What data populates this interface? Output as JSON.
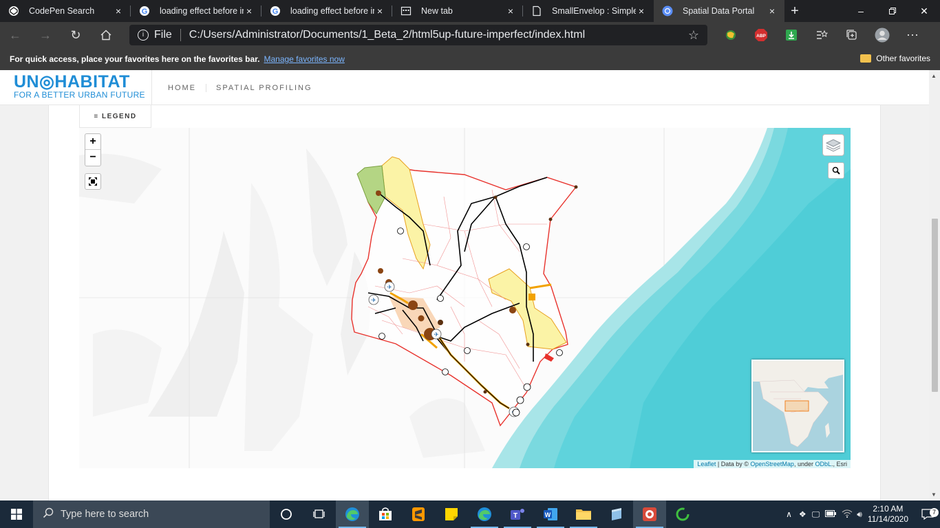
{
  "browser": {
    "tabs": [
      {
        "title": "CodePen Search",
        "icon": "codepen-icon",
        "active": false
      },
      {
        "title": "loading effect before in",
        "icon": "google-icon",
        "active": false
      },
      {
        "title": "loading effect before in",
        "icon": "google-icon",
        "active": false
      },
      {
        "title": "New tab",
        "icon": "new-tab-icon",
        "active": false
      },
      {
        "title": "SmallEnvelop : Simple F",
        "icon": "page-icon",
        "active": false
      },
      {
        "title": "Spatial Data Portal",
        "icon": "site-icon",
        "active": true
      }
    ],
    "close_glyph": "×",
    "new_tab_glyph": "+",
    "address": {
      "scheme_label": "File",
      "url": "C:/Users/Administrator/Documents/1_Beta_2/html5up-future-imperfect/index.html"
    },
    "extensions": {
      "abp_label": "ABP"
    },
    "favorites_bar": {
      "message": "For quick access, place your favorites here on the favorites bar.",
      "manage_link": "Manage favorites now",
      "other_favorites": "Other favorites"
    }
  },
  "site": {
    "logo": {
      "title": "UN◎HABITAT",
      "tagline": "FOR A BETTER URBAN FUTURE"
    },
    "nav": [
      {
        "label": "HOME"
      },
      {
        "label": "SPATIAL PROFILING"
      }
    ],
    "legend_button": "≡ LEGEND",
    "map": {
      "zoom_in": "+",
      "zoom_out": "−",
      "attribution": {
        "leaflet": "Leaflet",
        "data_by": " | Data by © ",
        "osm": "OpenStreetMap",
        "under": ", under ",
        "odbl": "ODbL",
        "esri": "., Esri"
      }
    }
  },
  "taskbar": {
    "search_placeholder": "Type here to search",
    "time": "2:10 AM",
    "date": "11/14/2020",
    "notification_count": "7"
  },
  "colors": {
    "logo_blue": "#1f8dd6",
    "sea": "#5fd3dc",
    "border_red": "#e8322c",
    "road_black": "#000000",
    "yellow_region": "#fbf3a6",
    "green_region": "#b4d584",
    "city_brown": "#8b4513"
  }
}
